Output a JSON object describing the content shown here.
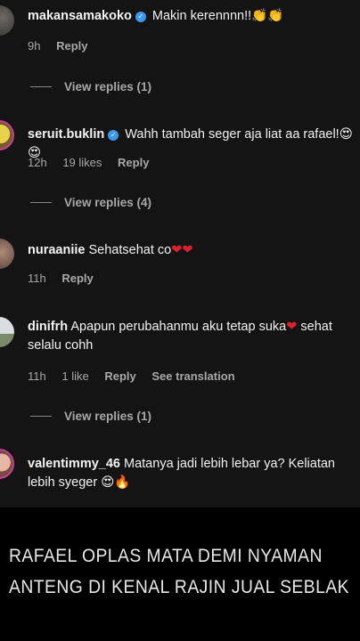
{
  "comments": [
    {
      "username": "makansamakoko",
      "verified": true,
      "text": "Makin kerennnn!!",
      "emoji": "👏👏",
      "time": "9h",
      "likes": "",
      "reply_label": "Reply",
      "translation_label": "",
      "view_replies": "View replies (1)"
    },
    {
      "username": "seruit.buklin",
      "verified": true,
      "text": "Wahh tambah seger aja liat aa rafael!",
      "emoji": "😍😍",
      "time": "12h",
      "likes": "19 likes",
      "reply_label": "Reply",
      "translation_label": "",
      "view_replies": "View replies (4)"
    },
    {
      "username": "nuraaniie",
      "verified": false,
      "text": "Sehatsehat co",
      "emoji": "❤❤",
      "time": "11h",
      "likes": "",
      "reply_label": "Reply",
      "translation_label": "",
      "view_replies": ""
    },
    {
      "username": "dinifrh",
      "verified": false,
      "text": "Apapun perubahanmu aku tetap suka",
      "emoji": "❤",
      "text_after": " sehat selalu cohh",
      "time": "11h",
      "likes": "1 like",
      "reply_label": "Reply",
      "translation_label": "See translation",
      "view_replies": "View replies (1)"
    },
    {
      "username": "valentimmy_46",
      "verified": false,
      "text": "Matanya jadi lebih lebar ya? Keliatan lebih syeger",
      "emoji": "😍🔥",
      "time": "",
      "likes": "",
      "reply_label": "",
      "translation_label": "",
      "view_replies": ""
    }
  ],
  "banner": {
    "line1": "RAFAEL OPLAS MATA DEMI NYAMAN",
    "line2": "ANTENG DI KENAL RAJIN JUAL SEBLAK"
  },
  "colors": {
    "background": "#141415",
    "muted_text": "#a8a8a8",
    "verified_badge": "#3b97f0",
    "heart": "#e0202e",
    "banner_bg": "#000000"
  }
}
